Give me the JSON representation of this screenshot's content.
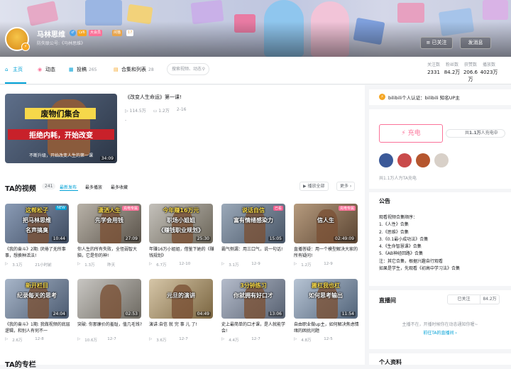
{
  "header": {
    "username": "马林思维",
    "level": "LV6",
    "vip_badge": "大会员",
    "medal_name": "闲猫",
    "medal_level": "17",
    "sign": "防失联公号:《马林思维》",
    "follow_label": "已关注",
    "message_label": "发消息"
  },
  "nav": {
    "tabs": [
      {
        "label": "主页",
        "count": ""
      },
      {
        "label": "动态",
        "count": ""
      },
      {
        "label": "投稿",
        "count": "265"
      },
      {
        "label": "合集和列表",
        "count": "28"
      }
    ],
    "search_placeholder": "搜索视频、动态"
  },
  "stats": [
    {
      "label": "关注数",
      "value": "2331"
    },
    {
      "label": "粉丝数",
      "value": "84.2万"
    },
    {
      "label": "获赞数",
      "value": "206.6万"
    },
    {
      "label": "播放数",
      "value": "4023万"
    }
  ],
  "featured": {
    "title": "《改变人生命运》第一课!",
    "views": "114.5万",
    "comments": "1.2万",
    "date": "2-16",
    "desc": "-",
    "duration": "34:09",
    "thumb_line1": "废物们集合",
    "thumb_line2": "拒绝内耗，开始改变",
    "thumb_sub": "不断升级，开始改变人生的第一课"
  },
  "videos_section": {
    "title": "TA的视频",
    "count": "241",
    "sort_tabs": [
      "最新发布",
      "最多播放",
      "最多收藏"
    ],
    "play_all": "播放全部",
    "more": "更多"
  },
  "videos": [
    {
      "caption_top": "这帮松子",
      "caption_mid": "把马林思维",
      "caption_bot": "名声搞臭",
      "tag": "NEW",
      "duration": "10:44",
      "title": "《我的奋斗》2期: 厌倦了无所事事，想换种活法!",
      "views": "3.1万",
      "date": "21小时前"
    },
    {
      "caption_top": "潇洒人生",
      "caption_mid": "先学会用钱",
      "caption_bot": "",
      "tag": "充电专属",
      "duration": "27:09",
      "title": "你人生的所有失败，全怪弱智大脑，它是你的神!",
      "views": "1.3万",
      "date": "昨天"
    },
    {
      "caption_top": "今年赚16万元",
      "caption_mid": "职场小姐姐",
      "caption_bot": "《赚钱职业规划》",
      "tag": "",
      "duration": "25:30",
      "title": "年赚16万小姐姐，借鉴下她的《赚钱规划》",
      "views": "6.7万",
      "date": "12-10"
    },
    {
      "caption_top": "说话自信",
      "caption_mid": "富有情绪感染力",
      "caption_bot": "",
      "tag": "已看",
      "duration": "15:05",
      "title": "霸气侧漏：用三口气，说一句话!",
      "views": "3.1万",
      "date": "12-9"
    },
    {
      "caption_top": "",
      "caption_mid": "信人生",
      "caption_bot": "",
      "tag": "充电专属",
      "duration": "02:49:09",
      "title": "直播答疑：用一个模型解决大家的所有疑问!",
      "views": "1.2万",
      "date": "12-9"
    },
    {
      "caption_top": "新开栏目",
      "caption_mid": "纪录每天的思考",
      "caption_bot": "",
      "tag": "",
      "duration": "24:04",
      "title": "《我的奋斗》1期: 我做视频的底层逻辑，和别人有何不一",
      "views": "2.6万",
      "date": "12-8"
    },
    {
      "caption_top": "",
      "caption_mid": "",
      "caption_bot": "",
      "tag": "",
      "duration": "02:53",
      "title": "突破: 你那廉价的羞耻，值几毛钱?",
      "views": "10.6万",
      "date": "12-7"
    },
    {
      "caption_top": "",
      "caption_mid": "元旦的演讲",
      "caption_bot": "",
      "tag": "",
      "duration": "04:49",
      "title": "演讲:自信 就 完 事 儿 了!",
      "views": "3.6万",
      "date": "12-7"
    },
    {
      "caption_top": "3分钟练习",
      "caption_mid": "你就拥有好口才",
      "caption_bot": "",
      "tag": "",
      "duration": "13:06",
      "title": "史上最简单的口才课，是人就能学会!",
      "views": "4.4万",
      "date": "12-7"
    },
    {
      "caption_top": "搬杠我也杠",
      "caption_mid": "如何思考输出",
      "caption_bot": "",
      "tag": "",
      "duration": "11:54",
      "title": "自由职业做up主，如何解决焦虑情绪的困扰问题",
      "views": "4.8万",
      "date": "12-5"
    }
  ],
  "next_section_title": "TA的专栏",
  "sidebar": {
    "cert": "bilibili个人认证：bilibili 知名UP主",
    "charge_button": "充电",
    "charge_count_prefix": "共",
    "charge_count": "1.1万",
    "charge_count_suffix": "人充电中",
    "charge_footer": "共1.1万人为TA充电",
    "notice_title": "公告",
    "notice_lines": [
      "观看视频合集顺序：",
      "1.《人性》合集",
      "2.《思维》合集",
      "3.《0.1最小成功法》合集",
      "4.《生命智慧课》合集",
      "5.《AB神经回路》合集",
      "注：其它合集，根据兴趣自行观看",
      "如果是学生，先观看《初高中学习法》合集"
    ],
    "live_title": "直播间",
    "live_follow": "已关注",
    "live_fans": "84.2万",
    "live_desc": "主播不在，开播时候你在动态通知你喔~",
    "live_link": "前往TA的直播间",
    "profile_title": "个人资料"
  },
  "colors": {
    "accent": "#00a1d6",
    "pink": "#fb7299",
    "gold": "#f5a623"
  }
}
